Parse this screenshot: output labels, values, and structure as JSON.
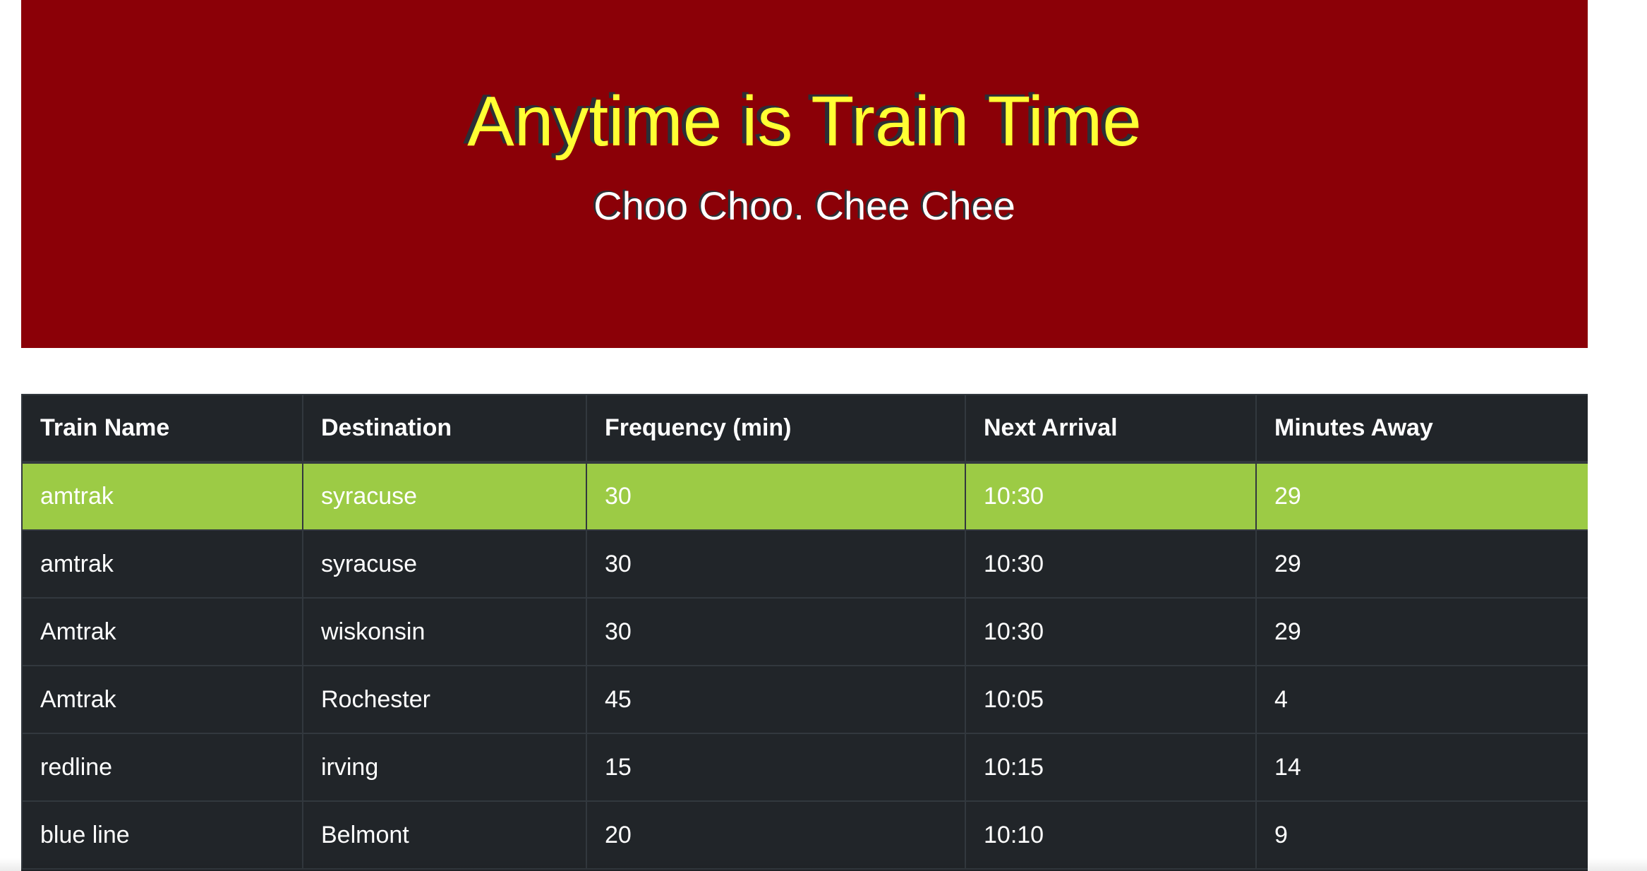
{
  "header": {
    "title": "Anytime is Train Time",
    "subtitle": "Choo Choo. Chee Chee"
  },
  "colors": {
    "jumbotron_bg": "#8b0007",
    "title_color": "#ffff33",
    "table_bg": "#212529",
    "highlight_row": "#9ccb45"
  },
  "table": {
    "columns": [
      "Train Name",
      "Destination",
      "Frequency (min)",
      "Next Arrival",
      "Minutes Away"
    ],
    "rows": [
      [
        "amtrak",
        "syracuse",
        "30",
        "10:30",
        "29"
      ],
      [
        "amtrak",
        "syracuse",
        "30",
        "10:30",
        "29"
      ],
      [
        "Amtrak",
        "wiskonsin",
        "30",
        "10:30",
        "29"
      ],
      [
        "Amtrak",
        "Rochester",
        "45",
        "10:05",
        "4"
      ],
      [
        "redline",
        "irving",
        "15",
        "10:15",
        "14"
      ],
      [
        "blue line",
        "Belmont",
        "20",
        "10:10",
        "9"
      ]
    ]
  }
}
